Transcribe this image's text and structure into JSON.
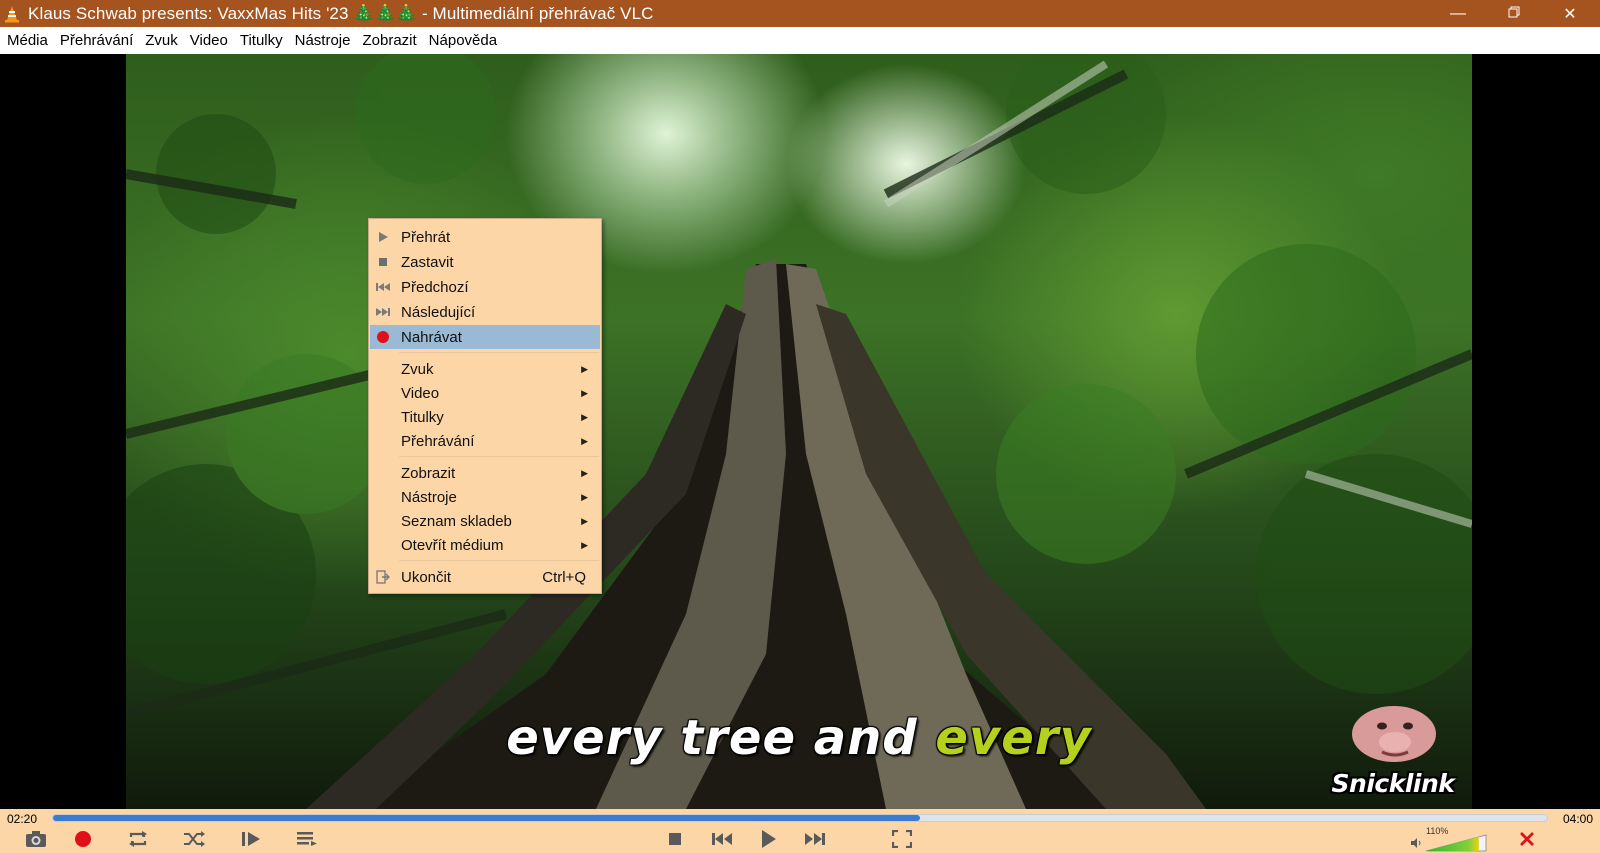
{
  "window": {
    "title": "Klaus Schwab presents: VaxxMas Hits '23 🎄🎄🎄 - Multimediální přehrávač VLC",
    "app_icon": "vlc-cone-icon",
    "controls": [
      "minimize-icon",
      "maximize-icon",
      "close-icon"
    ]
  },
  "menubar": {
    "items": [
      "Média",
      "Přehrávání",
      "Zvuk",
      "Video",
      "Titulky",
      "Nástroje",
      "Zobrazit",
      "Nápověda"
    ]
  },
  "video": {
    "subtitle_white": "every tree and",
    "subtitle_highlight": "every",
    "watermark": "Snicklink"
  },
  "context_menu": {
    "items": [
      {
        "label": "Přehrát",
        "icon": "play-icon"
      },
      {
        "label": "Zastavit",
        "icon": "stop-icon"
      },
      {
        "label": "Předchozí",
        "icon": "previous-icon"
      },
      {
        "label": "Následující",
        "icon": "next-icon"
      },
      {
        "label": "Nahrávat",
        "icon": "record-icon",
        "highlighted": true
      },
      {
        "label": "Zvuk",
        "submenu": true
      },
      {
        "label": "Video",
        "submenu": true
      },
      {
        "label": "Titulky",
        "submenu": true
      },
      {
        "label": "Přehrávání",
        "submenu": true
      },
      {
        "label": "Zobrazit",
        "submenu": true
      },
      {
        "label": "Nástroje",
        "submenu": true
      },
      {
        "label": "Seznam skladeb",
        "submenu": true
      },
      {
        "label": "Otevřít médium",
        "submenu": true
      },
      {
        "label": "Ukončit",
        "icon": "exit-icon",
        "shortcut": "Ctrl+Q"
      }
    ]
  },
  "player": {
    "time_current": "02:20",
    "time_total": "04:00",
    "progress_fraction": 0.58,
    "volume_label": "110%",
    "volume_fraction": 1.1,
    "accent_color": "#3d7bd0",
    "record_color": "#e0101a",
    "controls_bg": "#fdd6a8",
    "titlebar_color": "#a5531f"
  }
}
